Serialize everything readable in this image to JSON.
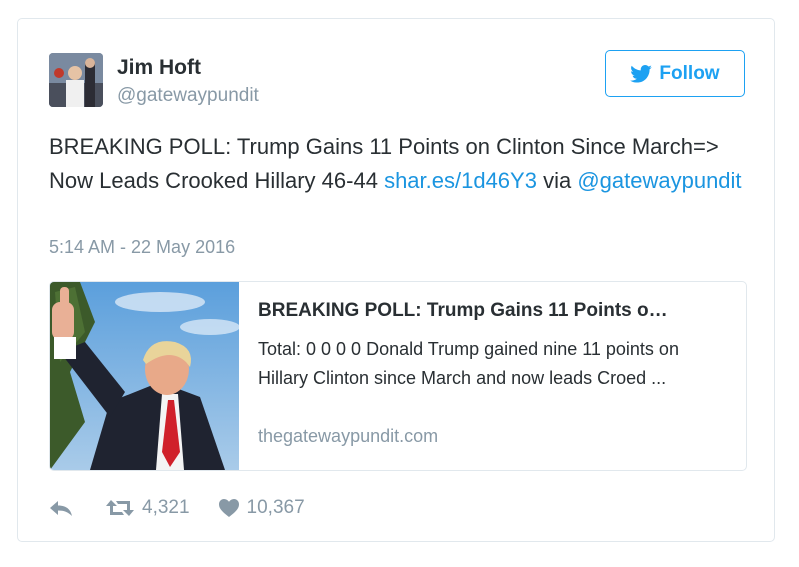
{
  "author": {
    "name": "Jim Hoft",
    "handle": "@gatewaypundit"
  },
  "follow_label": "Follow",
  "tweet": {
    "text_part1": "BREAKING POLL: Trump Gains 11 Points on Clinton Since March=> Now Leads Crooked Hillary 46-44 ",
    "link": "shar.es/1d46Y3",
    "text_part2": " via ",
    "mention": "@gatewaypundit",
    "timestamp": "5:14 AM - 22 May 2016"
  },
  "card": {
    "title": "BREAKING POLL: Trump Gains 11 Points o…",
    "description": "Total: 0 0 0 0 Donald Trump gained nine 11 points on Hillary Clinton since March and now leads Croed ...",
    "domain": "thegatewaypundit.com"
  },
  "actions": {
    "retweets": "4,321",
    "likes": "10,367"
  },
  "colors": {
    "accent": "#1da1f2",
    "link": "#1b95e0",
    "muted": "#8899a6",
    "text": "#292f33",
    "border": "#e1e8ed"
  },
  "icons": [
    "twitter-bird-icon",
    "reply-icon",
    "retweet-icon",
    "heart-icon"
  ]
}
